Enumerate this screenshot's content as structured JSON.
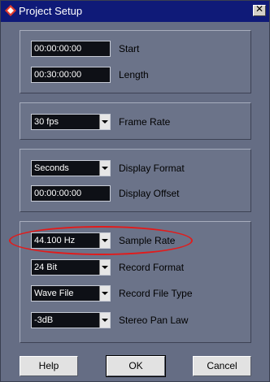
{
  "window": {
    "title": "Project Setup",
    "close_label": "✕"
  },
  "time": {
    "start_value": "00:00:00:00",
    "start_label": "Start",
    "length_value": "00:30:00:00",
    "length_label": "Length"
  },
  "frame": {
    "value": "30 fps",
    "label": "Frame Rate"
  },
  "display": {
    "format_value": "Seconds",
    "format_label": "Display Format",
    "offset_value": "00:00:00:00",
    "offset_label": "Display Offset"
  },
  "audio": {
    "sample_rate_value": "44.100 Hz",
    "sample_rate_label": "Sample Rate",
    "record_format_value": "24 Bit",
    "record_format_label": "Record Format",
    "file_type_value": "Wave File",
    "file_type_label": "Record File Type",
    "pan_law_value": "-3dB",
    "pan_law_label": "Stereo Pan Law"
  },
  "buttons": {
    "help": "Help",
    "ok": "OK",
    "cancel": "Cancel"
  },
  "colors": {
    "annotation": "#e21b1b",
    "title_bar": "#0f1a78"
  }
}
